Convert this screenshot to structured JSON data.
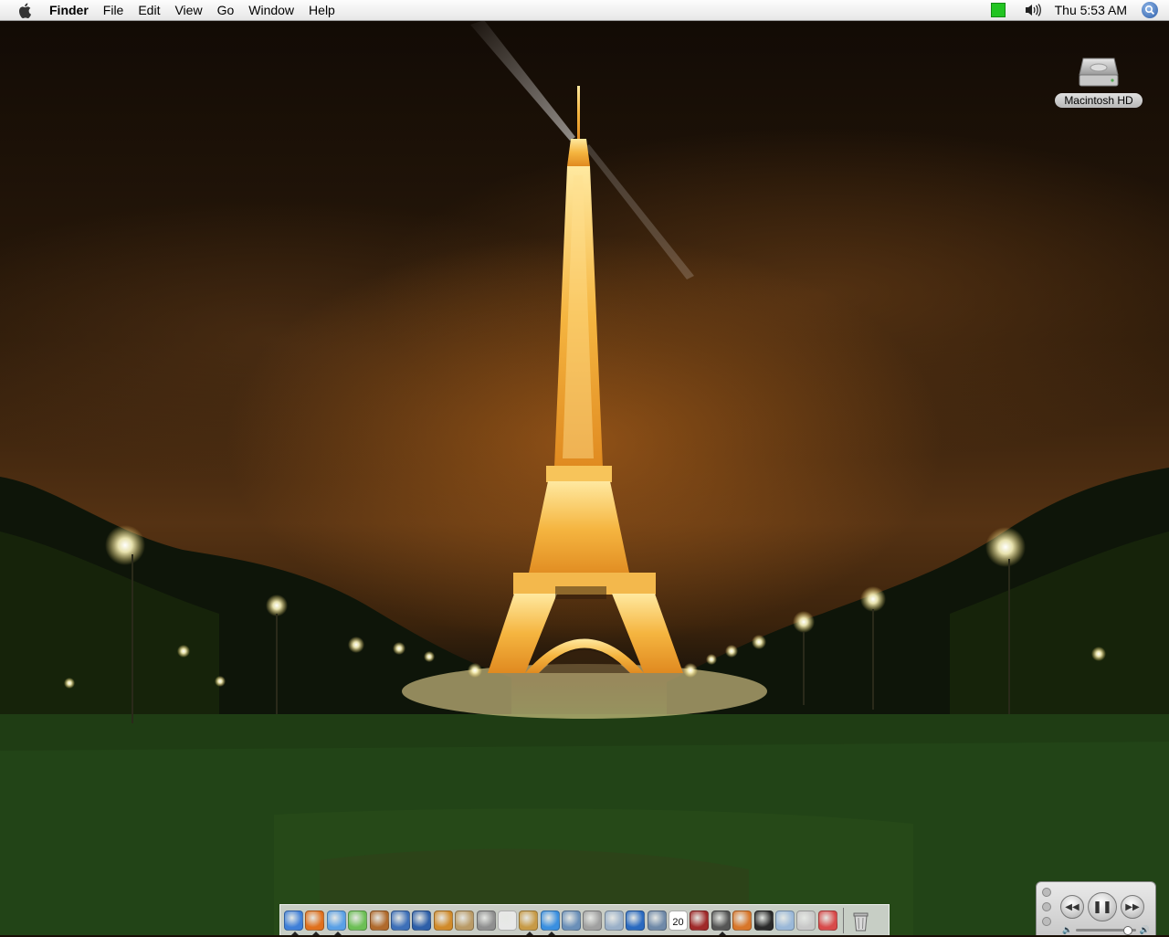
{
  "menubar": {
    "apple_icon": "apple-icon",
    "items": [
      {
        "label": "Finder",
        "bold": true
      },
      {
        "label": "File"
      },
      {
        "label": "Edit"
      },
      {
        "label": "View"
      },
      {
        "label": "Go"
      },
      {
        "label": "Window"
      },
      {
        "label": "Help"
      }
    ],
    "status": {
      "battery_color": "#22c422",
      "clock": "Thu 5:53 AM"
    }
  },
  "desktop": {
    "wallpaper": "eiffel-tower-night",
    "icons": [
      {
        "label": "Macintosh HD",
        "icon": "hard-drive-icon"
      }
    ]
  },
  "mini_player": {
    "buttons": [
      {
        "name": "rewind",
        "glyph": "◀◀"
      },
      {
        "name": "pause",
        "glyph": "❚❚"
      },
      {
        "name": "fast-forward",
        "glyph": "▶▶"
      }
    ],
    "volume_fraction": 0.85
  },
  "dock": {
    "apps": [
      {
        "name": "finder",
        "color": "#3f7fd8",
        "running": true
      },
      {
        "name": "firefox",
        "color": "#e0701d",
        "running": true
      },
      {
        "name": "ichat",
        "color": "#5aa0e6",
        "running": true
      },
      {
        "name": "itunes",
        "color": "#6cbf55",
        "running": false
      },
      {
        "name": "iphoto",
        "color": "#b06a2c",
        "running": false
      },
      {
        "name": "imovie",
        "color": "#3d6fb8",
        "running": false
      },
      {
        "name": "idvd",
        "color": "#2e5fa8",
        "running": false
      },
      {
        "name": "garageband",
        "color": "#d08a2a",
        "running": false
      },
      {
        "name": "ical-preview",
        "color": "#b99a66",
        "running": false
      },
      {
        "name": "script-editor",
        "color": "#8f8f8f",
        "running": false
      },
      {
        "name": "textedit",
        "color": "#e8e8e8",
        "running": false
      },
      {
        "name": "address-book",
        "color": "#c79a46",
        "running": true
      },
      {
        "name": "safari",
        "color": "#3a8fe0",
        "running": true
      },
      {
        "name": "mail",
        "color": "#6a8fb8",
        "running": false
      },
      {
        "name": "automator",
        "color": "#a0a0a0",
        "running": false
      },
      {
        "name": "preview",
        "color": "#9ab0c8",
        "running": false
      },
      {
        "name": "internet-connect",
        "color": "#2a6ac0",
        "running": false
      },
      {
        "name": "system-preferences",
        "color": "#6f89a8",
        "running": false
      },
      {
        "name": "ical",
        "color": "#ffffff",
        "calendar": "20",
        "running": false
      },
      {
        "name": "dictionary",
        "color": "#a02a2a",
        "running": false
      },
      {
        "name": "chess",
        "color": "#555555",
        "running": true
      },
      {
        "name": "umbrella-app",
        "color": "#d8762a",
        "running": false
      },
      {
        "name": "terminal",
        "color": "#2a2a2a",
        "running": false
      },
      {
        "name": "utility",
        "color": "#9ab8d8",
        "running": false
      },
      {
        "name": "console",
        "color": "#c8c8c8",
        "running": false
      },
      {
        "name": "font-app",
        "color": "#d84a4a",
        "running": false
      }
    ],
    "trash_icon": "trash-icon"
  }
}
